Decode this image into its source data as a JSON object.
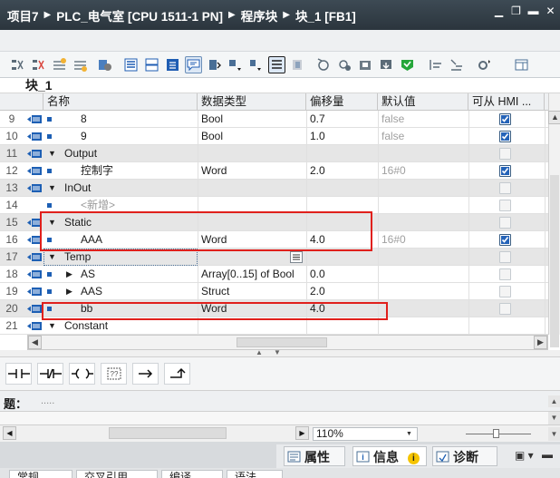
{
  "title": {
    "project": "项目7",
    "plc": "PLC_电气室 [CPU 1511-1 PN]",
    "folder": "程序块",
    "block": "块_1 [FB1]"
  },
  "block_label": "块_1",
  "columns": {
    "name": "名称",
    "type": "数据类型",
    "offset": "偏移量",
    "default": "默认值",
    "hmi": "可从 HMI ..."
  },
  "rows": [
    {
      "num": "9",
      "name": "8",
      "type": "Bool",
      "offset": "0.7",
      "default": "false",
      "hmi": true,
      "indent": 2,
      "expander": "",
      "kind": "var"
    },
    {
      "num": "10",
      "name": "9",
      "type": "Bool",
      "offset": "1.0",
      "default": "false",
      "hmi": true,
      "indent": 2,
      "expander": "",
      "kind": "var"
    },
    {
      "num": "11",
      "name": "Output",
      "type": "",
      "offset": "",
      "default": "",
      "hmi": false,
      "indent": 1,
      "expander": "down",
      "kind": "section"
    },
    {
      "num": "12",
      "name": "控制字",
      "type": "Word",
      "offset": "2.0",
      "default": "16#0",
      "hmi": true,
      "indent": 2,
      "expander": "",
      "kind": "var"
    },
    {
      "num": "13",
      "name": "InOut",
      "type": "",
      "offset": "",
      "default": "",
      "hmi": false,
      "indent": 1,
      "expander": "down",
      "kind": "section"
    },
    {
      "num": "14",
      "name": "<新增>",
      "type": "",
      "offset": "",
      "default": "",
      "hmi": false,
      "indent": 2,
      "expander": "",
      "kind": "add"
    },
    {
      "num": "15",
      "name": "Static",
      "type": "",
      "offset": "",
      "default": "",
      "hmi": false,
      "indent": 1,
      "expander": "down",
      "kind": "section"
    },
    {
      "num": "16",
      "name": "AAA",
      "type": "Word",
      "offset": "4.0",
      "default": "16#0",
      "hmi": true,
      "indent": 2,
      "expander": "",
      "kind": "var"
    },
    {
      "num": "17",
      "name": "Temp",
      "type": "",
      "offset": "",
      "default": "",
      "hmi": false,
      "indent": 1,
      "expander": "down",
      "kind": "section"
    },
    {
      "num": "18",
      "name": "AS",
      "type": "Array[0..15] of Bool",
      "offset": "0.0",
      "default": "",
      "hmi": false,
      "indent": 2,
      "expander": "right",
      "kind": "var"
    },
    {
      "num": "19",
      "name": "AAS",
      "type": "Struct",
      "offset": "2.0",
      "default": "",
      "hmi": false,
      "indent": 2,
      "expander": "right",
      "kind": "var"
    },
    {
      "num": "20",
      "name": "bb",
      "type": "Word",
      "offset": "4.0",
      "default": "",
      "hmi": false,
      "indent": 2,
      "expander": "",
      "kind": "var"
    },
    {
      "num": "21",
      "name": "Constant",
      "type": "",
      "offset": "",
      "default": "",
      "hmi": false,
      "indent": 1,
      "expander": "down",
      "kind": "section"
    }
  ],
  "network_title_label": "题：",
  "network_title_value": ".....",
  "zoom": "110%",
  "property_tabs": {
    "properties": "属性",
    "info": "信息",
    "diagnostics": "诊断"
  },
  "bottom_tabs": [
    "常规",
    "交叉引用",
    "编译",
    "语法"
  ]
}
